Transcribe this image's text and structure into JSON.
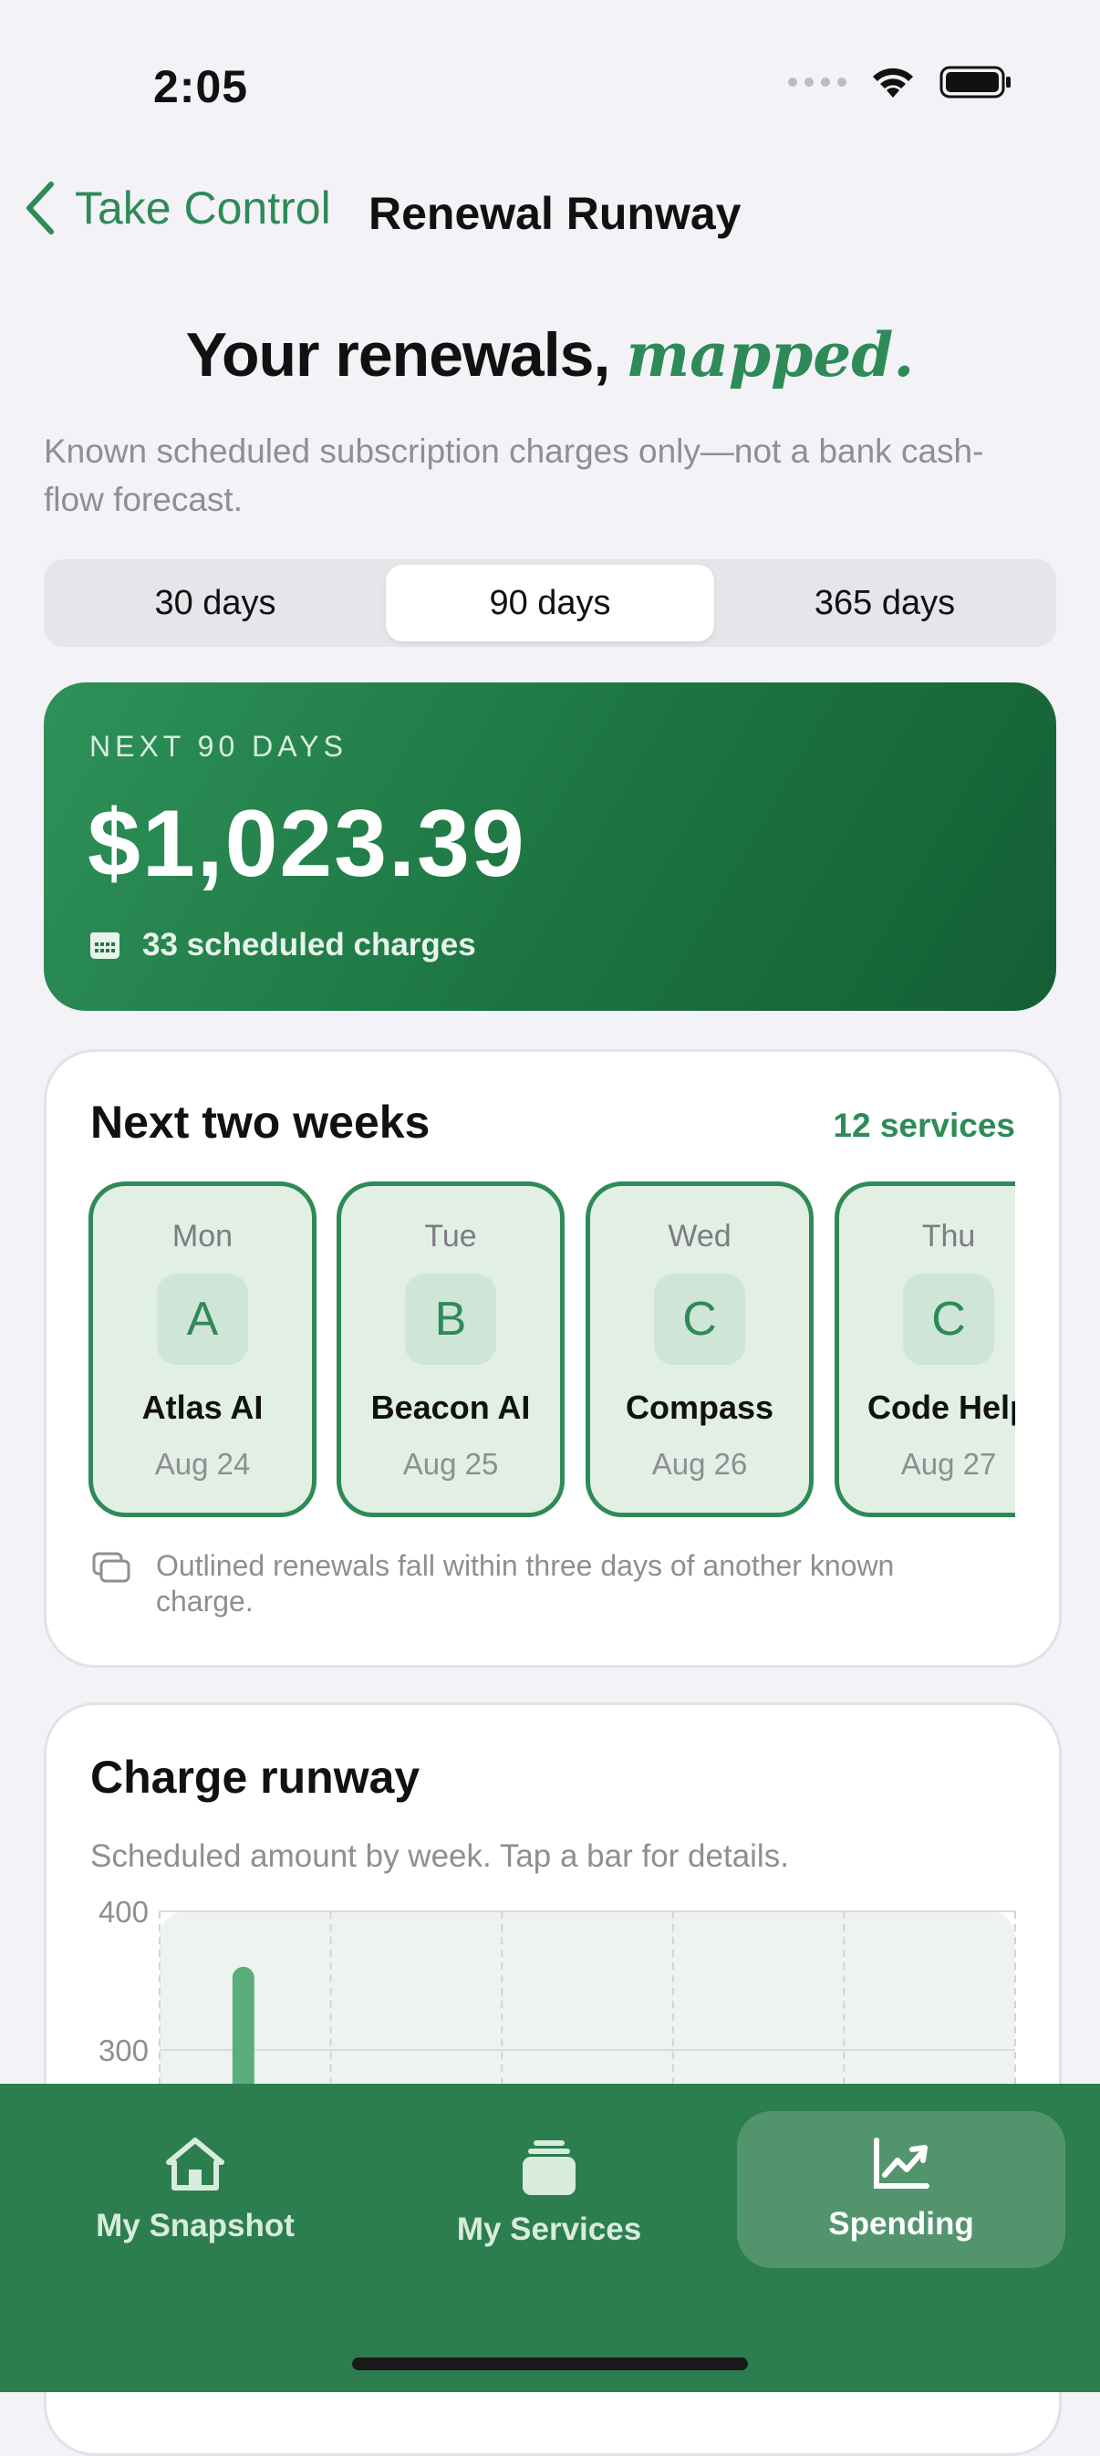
{
  "status_bar": {
    "time": "2:05"
  },
  "nav": {
    "back_label": "Take Control",
    "title": "Renewal Runway"
  },
  "hero": {
    "title": "Your renewals,",
    "accent": "mapped."
  },
  "subtitle": "Known scheduled subscription charges only—not a bank cash-flow forecast.",
  "segmented": {
    "options": [
      "30 days",
      "90 days",
      "365 days"
    ],
    "selected": "90 days"
  },
  "summary": {
    "label": "NEXT 90 DAYS",
    "amount": "$1,023.39",
    "charges_text": "33 scheduled charges",
    "icon": "calendar-icon"
  },
  "next_two_weeks": {
    "title": "Next two weeks",
    "count_label": "12 services",
    "items": [
      {
        "day": "Mon",
        "initial": "A",
        "name": "Atlas AI",
        "date": "Aug 24"
      },
      {
        "day": "Tue",
        "initial": "B",
        "name": "Beacon AI",
        "date": "Aug 25"
      },
      {
        "day": "Wed",
        "initial": "C",
        "name": "Compass",
        "date": "Aug 26"
      },
      {
        "day": "Thu",
        "initial": "C",
        "name": "Code Help",
        "date": "Aug 27"
      }
    ],
    "note": "Outlined renewals fall within three days of another known charge.",
    "note_icon": "stacked-cards-icon"
  },
  "charge_runway": {
    "title": "Charge runway",
    "subtitle": "Scheduled amount by week. Tap a bar for details."
  },
  "chart_data": {
    "type": "bar",
    "title": "Charge runway",
    "y_ticks": [
      "400",
      "300"
    ],
    "ylim_visible": [
      300,
      400
    ],
    "values": [
      360
    ],
    "grid": true
  },
  "tabbar": {
    "tabs": [
      {
        "label": "My Snapshot",
        "icon": "house-icon"
      },
      {
        "label": "My Services",
        "icon": "stack-icon"
      },
      {
        "label": "Spending",
        "icon": "trend-chart-icon"
      }
    ],
    "selected": "Spending"
  },
  "colors": {
    "accent": "#2E8A57",
    "tabbar": "#2C7E4E",
    "summary_gradient_start": "#2E9159",
    "summary_gradient_end": "#145F35"
  }
}
